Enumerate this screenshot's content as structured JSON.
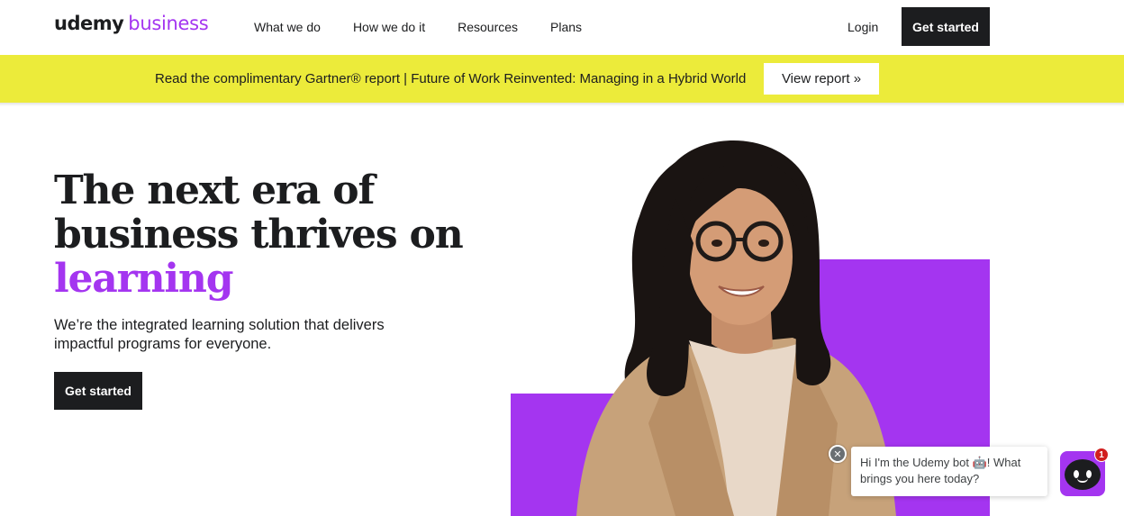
{
  "header": {
    "logo_udemy": "udemy",
    "logo_business": "business",
    "nav": [
      "What we do",
      "How we do it",
      "Resources",
      "Plans"
    ],
    "login_label": "Login",
    "cta_label": "Get started"
  },
  "banner": {
    "text": "Read the complimentary Gartner® report | Future of Work Reinvented: Managing in a Hybrid World",
    "button_label": "View report »"
  },
  "hero": {
    "headline_line1": "The next era of",
    "headline_line2": "business thrives on",
    "headline_accent": "learning",
    "subtext": "We’re the integrated learning solution that delivers impactful programs for everyone.",
    "cta_label": "Get started"
  },
  "chat": {
    "message": "Hi I'm the Udemy bot 🤖! What brings you here today?",
    "badge_count": "1",
    "close_icon": "close-icon",
    "bot_icon": "chat-bot-icon"
  },
  "colors": {
    "accent": "#a435f0",
    "banner": "#eceb3a",
    "dark": "#1c1d1f"
  }
}
